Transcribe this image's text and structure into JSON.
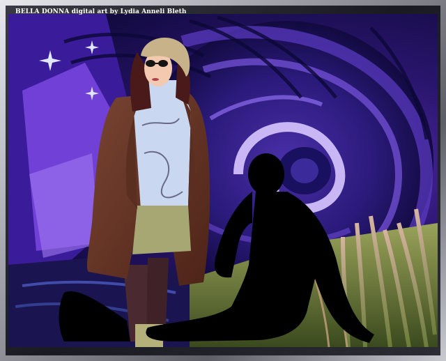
{
  "caption": "BELLA DONNA digital art by Lydia Anneli Bleth",
  "palette": {
    "background_dark": "#0b0a2e",
    "violet": "#7a3fe0",
    "lavender": "#b89af5",
    "coat_brown": "#6e3a2a",
    "sweater": "#c9d8f0",
    "skirt": "#a7a774",
    "silhouette": "#000000",
    "grass_green": "#6a7c3a",
    "frame_grey": "#9fa0a8"
  },
  "scene": {
    "subject": "woman-in-coat",
    "silhouette": "seated-man-silhouette",
    "backdrop": "peacock-feather-swirl"
  }
}
